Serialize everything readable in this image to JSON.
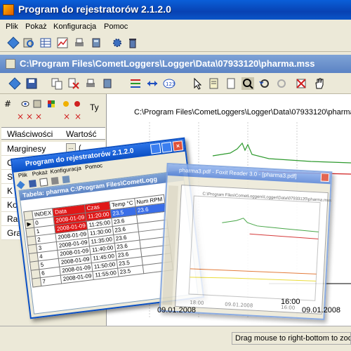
{
  "window": {
    "title": "Program do rejestratorów   2.1.2.0"
  },
  "menu": [
    "Plik",
    "Pokaż",
    "Konfiguracja",
    "Pomoc"
  ],
  "child": {
    "title": "C:\\Program Files\\CometLoggers\\Logger\\Data\\07933120\\pharma.mss"
  },
  "props": {
    "col_key": "Właściwości",
    "col_val": "Wartość",
    "type_label": "Ty",
    "rows": [
      {
        "key": "Marginesy",
        "value": "("
      },
      {
        "key": "Obraz w tle",
        "value": "(B"
      },
      {
        "key": "Skos",
        "value": ""
      },
      {
        "key": "K",
        "value": ""
      },
      {
        "key": "Ko",
        "value": ""
      },
      {
        "key": "Ram",
        "value": ""
      },
      {
        "key": "Gradie",
        "value": ""
      }
    ]
  },
  "chart": {
    "path_label": "C:\\Program Files\\CometLoggers\\Logger\\Data\\07933120\\pharma.m",
    "x_ticks": [
      "09.01.2008",
      "16:00",
      "09.01.2008"
    ],
    "colors": {
      "green": "#2e9a2e",
      "red": "#d02020",
      "yellow": "#e8d820",
      "grid": "#cfcfcf"
    }
  },
  "status": {
    "hint": "Drag mouse to right-bottom to zoom"
  },
  "table_window": {
    "title": "Program do rejestratorów   2.1.2.0",
    "menu": [
      "Plik",
      "Pokaż",
      "Konfiguracja",
      "Pomoc"
    ],
    "inner_title": "Tabela: pharma  C:\\Program Files\\CometLogg",
    "headers": [
      "INDEX",
      "Data",
      "Czas",
      "Temp °C",
      "Num RPM"
    ],
    "rows": [
      {
        "index": "0",
        "date": "2008-01-09",
        "time": "11:20:00",
        "temp": "23.5",
        "num": "23.6"
      },
      {
        "index": "1",
        "date": "2008-01-09",
        "time": "11:25:00",
        "temp": "23.6",
        "num": ""
      },
      {
        "index": "2",
        "date": "2008-01-09",
        "time": "11:30:00",
        "temp": "23.6",
        "num": ""
      },
      {
        "index": "3",
        "date": "2008-01-09",
        "time": "11:35:00",
        "temp": "23.6",
        "num": ""
      },
      {
        "index": "4",
        "date": "2008-01-09",
        "time": "11:40:00",
        "temp": "23.6",
        "num": ""
      },
      {
        "index": "5",
        "date": "2008-01-09",
        "time": "11:45:00",
        "temp": "23.6",
        "num": ""
      },
      {
        "index": "6",
        "date": "2008-01-09",
        "time": "11:50:00",
        "temp": "23.5",
        "num": ""
      },
      {
        "index": "7",
        "date": "2008-01-09",
        "time": "11:55:00",
        "temp": "23.5",
        "num": ""
      }
    ]
  },
  "pdf_window": {
    "title": "pharma3.pdf - Foxit Reader 3.0 - [pharma3.pdf]",
    "page_path": "C:\\Program Files\\CometLoggers\\Logger\\Data\\07933120\\pharma.mss",
    "x_ticks": [
      "18:00",
      "09.01.2008",
      "16:00"
    ]
  }
}
